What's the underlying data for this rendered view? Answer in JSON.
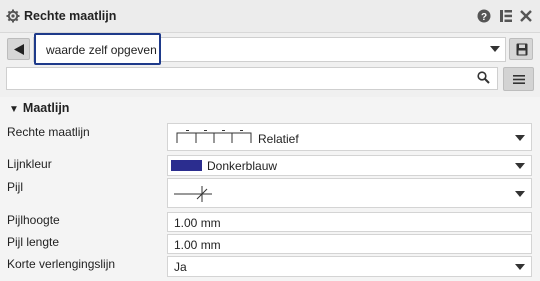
{
  "header": {
    "title": "Rechte maatlijn",
    "icons": [
      "gear-icon",
      "help-icon",
      "dock-icon",
      "close-icon"
    ]
  },
  "toolbar": {
    "back_icon": "triangle-left-icon",
    "combo_value": "waarde zelf opgeven",
    "save_icon": "save-icon"
  },
  "search": {
    "placeholder": "",
    "search_icon": "magnifier-icon",
    "menu_icon": "list-icon"
  },
  "section": {
    "title": "Maatlijn",
    "rows": [
      {
        "label": "Rechte maatlijn",
        "value": "Relatief"
      },
      {
        "label": "Lijnkleur",
        "value": "Donkerblauw",
        "color": "#2b2d8f"
      },
      {
        "label": "Pijl",
        "value": ""
      },
      {
        "label": "Pijlhoogte",
        "value": "1.00 mm"
      },
      {
        "label": "Pijl lengte",
        "value": "1.00 mm"
      },
      {
        "label": "Korte verlengingslijn",
        "value": "Ja"
      }
    ]
  },
  "colors": {
    "accent_outline": "#1e3a8a",
    "swatch": "#2b2d8f"
  }
}
